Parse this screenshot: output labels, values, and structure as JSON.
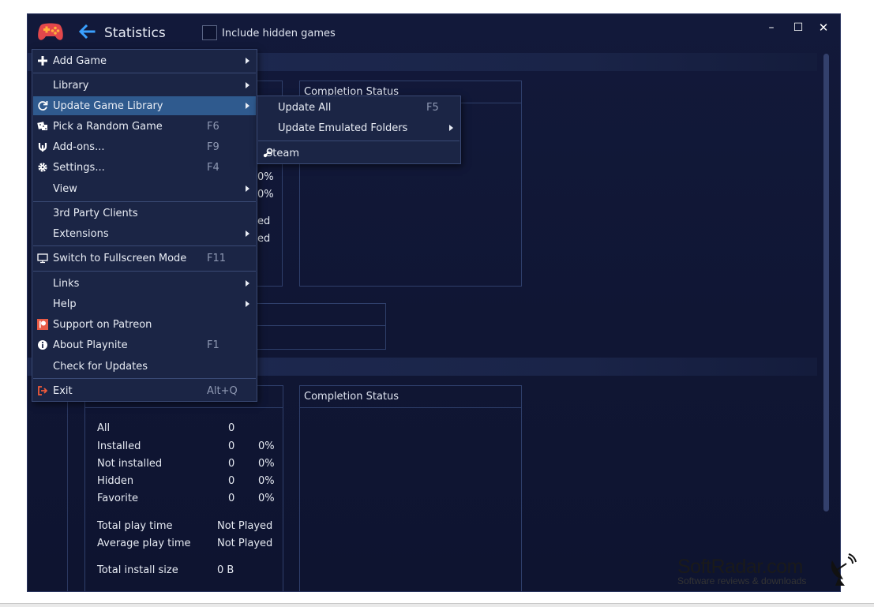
{
  "window": {
    "title": "Statistics",
    "include_hidden_label": "Include hidden games",
    "minimize": "–",
    "maximize": "☐",
    "close": "✕"
  },
  "colors": {
    "accent": "#2f5a8e",
    "menu_bg": "#1b2545",
    "window_bg": "#12193a",
    "back_arrow": "#3aa0ff"
  },
  "main_menu": [
    {
      "id": "add-game",
      "label": "Add Game",
      "icon": "plus-icon",
      "submenu": true
    },
    {
      "id": "library",
      "label": "Library",
      "submenu": true
    },
    {
      "id": "update-game-library",
      "label": "Update Game Library",
      "icon": "refresh-icon",
      "submenu": true,
      "highlighted": true
    },
    {
      "id": "pick-random-game",
      "label": "Pick a Random Game",
      "icon": "dice-icon",
      "shortcut": "F6"
    },
    {
      "id": "add-ons",
      "label": "Add-ons...",
      "icon": "plug-icon",
      "shortcut": "F9"
    },
    {
      "id": "settings",
      "label": "Settings...",
      "icon": "gear-icon",
      "shortcut": "F4"
    },
    {
      "id": "view",
      "label": "View",
      "submenu": true
    },
    {
      "id": "third-party-clients",
      "label": "3rd Party Clients"
    },
    {
      "id": "extensions",
      "label": "Extensions",
      "submenu": true
    },
    {
      "id": "fullscreen",
      "label": "Switch to Fullscreen Mode",
      "icon": "monitor-icon",
      "shortcut": "F11"
    },
    {
      "id": "links",
      "label": "Links",
      "submenu": true
    },
    {
      "id": "help",
      "label": "Help",
      "submenu": true
    },
    {
      "id": "patreon",
      "label": "Support on Patreon",
      "icon": "patreon-icon"
    },
    {
      "id": "about",
      "label": "About Playnite",
      "icon": "info-icon",
      "shortcut": "F1"
    },
    {
      "id": "check-updates",
      "label": "Check for Updates"
    },
    {
      "id": "exit",
      "label": "Exit",
      "icon": "exit-icon",
      "shortcut": "Alt+Q"
    }
  ],
  "submenu": [
    {
      "id": "update-all",
      "label": "Update All",
      "shortcut": "F5"
    },
    {
      "id": "update-emulated",
      "label": "Update Emulated Folders",
      "submenu": true
    },
    {
      "id": "steam",
      "label": "Steam",
      "icon": "steam-icon"
    }
  ],
  "top_section": {
    "completion_title": "Completion Status",
    "partial_values": [
      "0%",
      "0%",
      "ed",
      "ed"
    ]
  },
  "bottom_section": {
    "completion_title": "Completion Status",
    "rows": [
      {
        "label": "All",
        "count": "0",
        "percent": ""
      },
      {
        "label": "Installed",
        "count": "0",
        "percent": "0%"
      },
      {
        "label": "Not installed",
        "count": "0",
        "percent": "0%"
      },
      {
        "label": "Hidden",
        "count": "0",
        "percent": "0%"
      },
      {
        "label": "Favorite",
        "count": "0",
        "percent": "0%"
      }
    ],
    "play": [
      {
        "label": "Total play time",
        "value": "Not Played"
      },
      {
        "label": "Average play time",
        "value": "Not Played"
      }
    ],
    "install": {
      "label": "Total install size",
      "value": "0 B"
    }
  },
  "watermark": {
    "title": "SoftRadar.com",
    "subtitle": "Software reviews & downloads"
  }
}
